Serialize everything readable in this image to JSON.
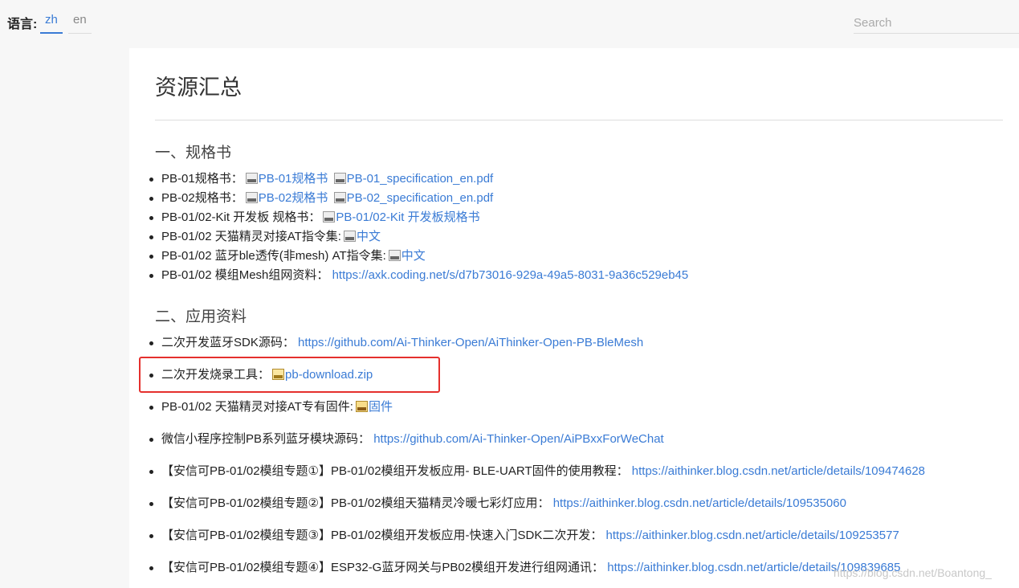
{
  "topbar": {
    "language_label": "语言:",
    "tabs": [
      {
        "label": "zh",
        "active": true
      },
      {
        "label": "en",
        "active": false
      }
    ],
    "search_placeholder": "Search"
  },
  "page": {
    "title": "资源汇总",
    "sections": [
      {
        "heading": "一、规格书",
        "items": [
          {
            "text": "PB-01规格书：",
            "links": [
              {
                "icon": "pdf-icon",
                "label": "PB-01规格书"
              },
              {
                "icon": "pdf-icon",
                "label": "PB-01_specification_en.pdf"
              }
            ]
          },
          {
            "text": "PB-02规格书：",
            "links": [
              {
                "icon": "pdf-icon",
                "label": "PB-02规格书"
              },
              {
                "icon": "pdf-icon",
                "label": "PB-02_specification_en.pdf"
              }
            ]
          },
          {
            "text": "PB-01/02-Kit 开发板 规格书：",
            "links": [
              {
                "icon": "pdf-icon",
                "label": "PB-01/02-Kit 开发板规格书"
              }
            ]
          },
          {
            "text": "PB-01/02 天猫精灵对接AT指令集:",
            "links": [
              {
                "icon": "pdf-icon",
                "label": "中文"
              }
            ]
          },
          {
            "text": "PB-01/02 蓝牙ble透传(非mesh) AT指令集:",
            "links": [
              {
                "icon": "pdf-icon",
                "label": "中文"
              }
            ]
          },
          {
            "text": "PB-01/02 模组Mesh组网资料：",
            "links": [
              {
                "icon": "",
                "label": "https://axk.coding.net/s/d7b73016-929a-49a5-8031-9a36c529eb45"
              }
            ]
          }
        ]
      },
      {
        "heading": "二、应用资料",
        "items": [
          {
            "text": "二次开发蓝牙SDK源码：",
            "links": [
              {
                "icon": "",
                "label": "https://github.com/Ai-Thinker-Open/AiThinker-Open-PB-BleMesh"
              }
            ]
          },
          {
            "text": "二次开发烧录工具：",
            "links": [
              {
                "icon": "zip-icon",
                "label": "pb-download.zip"
              }
            ]
          },
          {
            "text": "PB-01/02 天猫精灵对接AT专有固件:",
            "links": [
              {
                "icon": "rar-icon",
                "label": "固件"
              }
            ]
          },
          {
            "text": "微信小程序控制PB系列蓝牙模块源码：",
            "links": [
              {
                "icon": "",
                "label": "https://github.com/Ai-Thinker-Open/AiPBxxForWeChat"
              }
            ]
          },
          {
            "text": "【安信可PB-01/02模组专题①】PB-01/02模组开发板应用- BLE-UART固件的使用教程：",
            "links": [
              {
                "icon": "",
                "label": "https://aithinker.blog.csdn.net/article/details/109474628"
              }
            ]
          },
          {
            "text": "【安信可PB-01/02模组专题②】PB-01/02模组天猫精灵冷暖七彩灯应用：",
            "links": [
              {
                "icon": "",
                "label": "https://aithinker.blog.csdn.net/article/details/109535060"
              }
            ]
          },
          {
            "text": "【安信可PB-01/02模组专题③】PB-01/02模组开发板应用-快速入门SDK二次开发：",
            "links": [
              {
                "icon": "",
                "label": "https://aithinker.blog.csdn.net/article/details/109253577"
              }
            ]
          },
          {
            "text": "【安信可PB-01/02模组专题④】ESP32-G蓝牙网关与PB02模组开发进行组网通讯：",
            "links": [
              {
                "icon": "",
                "label": "https://aithinker.blog.csdn.net/article/details/109839685"
              }
            ]
          }
        ]
      }
    ]
  },
  "watermark": "https://blog.csdn.net/Boantong_",
  "colors": {
    "link": "#3a7bd5",
    "highlight_border": "#e5302d",
    "active_tab": "#3a7bd5"
  }
}
